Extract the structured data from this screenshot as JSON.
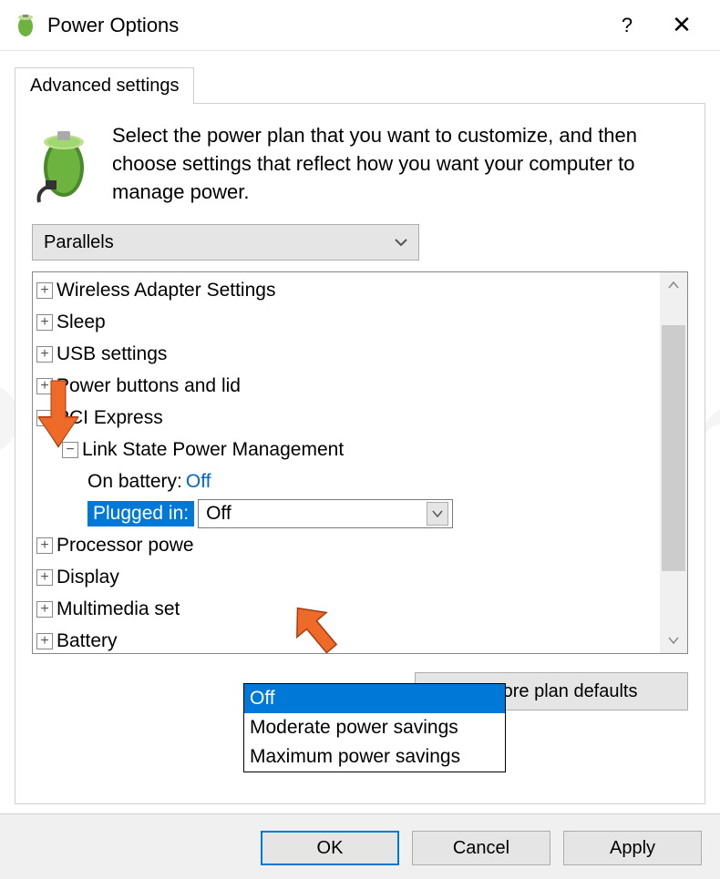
{
  "titlebar": {
    "title": "Power Options"
  },
  "tab": {
    "label": "Advanced settings"
  },
  "description": "Select the power plan that you want to customize, and then choose settings that reflect how you want your computer to manage power.",
  "planSelect": {
    "value": "Parallels"
  },
  "tree": {
    "items": [
      {
        "icon": "plus",
        "label": "Wireless Adapter Settings",
        "indent": 1
      },
      {
        "icon": "plus",
        "label": "Sleep",
        "indent": 1
      },
      {
        "icon": "plus",
        "label": "USB settings",
        "indent": 1
      },
      {
        "icon": "plus",
        "label": "Power buttons and lid",
        "indent": 1
      },
      {
        "icon": "minus",
        "label": "PCI Express",
        "indent": 1
      },
      {
        "icon": "minus",
        "label": "Link State Power Management",
        "indent": 2
      },
      {
        "icon": "none",
        "label": "On battery:",
        "value": "Off",
        "indent": 3
      },
      {
        "icon": "none",
        "label": "Plugged in:",
        "value": "Off",
        "indent": 3,
        "selected": true,
        "editing": true
      },
      {
        "icon": "plus",
        "label": "Processor powe",
        "indent": 1
      },
      {
        "icon": "plus",
        "label": "Display",
        "indent": 1
      },
      {
        "icon": "plus",
        "label": "Multimedia set",
        "indent": 1
      },
      {
        "icon": "plus",
        "label": "Battery",
        "indent": 1
      }
    ]
  },
  "dropdown": {
    "options": [
      "Off",
      "Moderate power savings",
      "Maximum power savings"
    ],
    "selected": "Off"
  },
  "buttons": {
    "restore": "Restore plan defaults",
    "ok": "OK",
    "cancel": "Cancel",
    "apply": "Apply"
  }
}
